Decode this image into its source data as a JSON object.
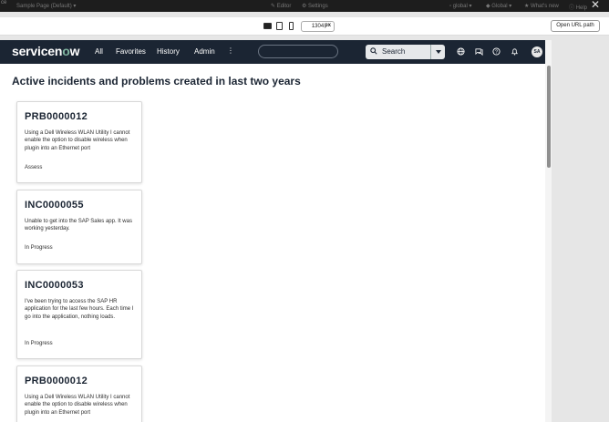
{
  "builder": {
    "page_selector": "Sample Page (Default) ▾",
    "editor": "Editor",
    "settings": "Settings",
    "scope": "global",
    "application": "Global",
    "whats_new": "What's new",
    "help": "Help",
    "left_code": "ce"
  },
  "viewport": {
    "width_value": "1304",
    "unit": "px",
    "open_url": "Open URL path"
  },
  "header": {
    "logo_prefix": "servicen",
    "logo_o": "o",
    "logo_suffix": "w",
    "nav": [
      "All",
      "Favorites",
      "History",
      "Admin"
    ],
    "more": "⋮",
    "search_label": "Search",
    "avatar_initials": "SA"
  },
  "content": {
    "title": "Active incidents and problems created in last two years",
    "cards": [
      {
        "number": "PRB0000012",
        "description": "Using a Dell Wireless WLAN Utility I cannot enable the option to disable wireless when plugin into an Ethernet port",
        "state": "Assess"
      },
      {
        "number": "INC0000055",
        "description": "Unable to get into the SAP Sales app. It was working yesterday.",
        "state": "In Progress"
      },
      {
        "number": "INC0000053",
        "description": "I've been trying to access the SAP HR application for the last few hours. Each time I go into the application, nothing loads.",
        "state": "In Progress"
      },
      {
        "number": "PRB0000012",
        "description": "Using a Dell Wireless WLAN Utility I cannot enable the option to disable wireless when plugin into an Ethernet port",
        "state": ""
      }
    ]
  },
  "colors": {
    "header_bg": "#1b2533",
    "logo_accent": "#81b5a1",
    "builder_bar": "#1d1d1d"
  }
}
